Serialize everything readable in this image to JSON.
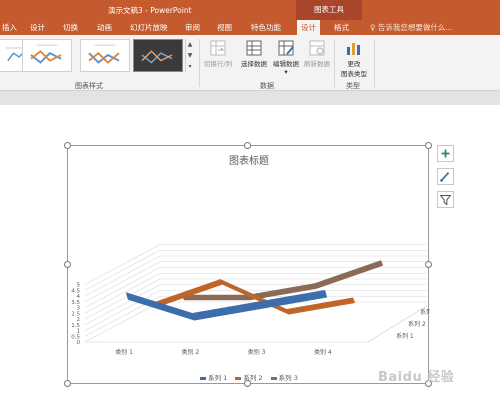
{
  "app": {
    "title": "演示文稿3 - PowerPoint",
    "context_group": "图表工具"
  },
  "tabs": [
    {
      "label": "插入"
    },
    {
      "label": "设计"
    },
    {
      "label": "切换"
    },
    {
      "label": "动画"
    },
    {
      "label": "幻灯片放映"
    },
    {
      "label": "审阅"
    },
    {
      "label": "视图"
    },
    {
      "label": "特色功能"
    },
    {
      "label": "设计",
      "active": true
    },
    {
      "label": "格式"
    }
  ],
  "tell_me": "告诉我您想要做什么...",
  "ribbon": {
    "groups": {
      "chart_styles": "图表样式",
      "data": "数据",
      "type": "类型"
    },
    "buttons": {
      "switch_row_col": "切换行/列",
      "select_data": "选择数据",
      "edit_data": "编辑数据",
      "refresh_data": "刷新数据",
      "change_chart_type_line1": "更改",
      "change_chart_type_line2": "图表类型"
    }
  },
  "chart_data": {
    "type": "line",
    "title": "图表标题",
    "categories": [
      "类别 1",
      "类别 2",
      "类别 3",
      "类别 4"
    ],
    "series": [
      {
        "name": "系列 1",
        "values": [
          4.3,
          2.5,
          3.5,
          4.5
        ],
        "color": "#3d6eab"
      },
      {
        "name": "系列 2",
        "values": [
          2.4,
          4.4,
          1.8,
          2.8
        ],
        "color": "#c0652a"
      },
      {
        "name": "系列 3",
        "values": [
          2.0,
          2.0,
          3.0,
          5.0
        ],
        "color": "#8c6a58"
      }
    ],
    "y_ticks": [
      "0",
      "0.5",
      "1",
      "1.5",
      "2",
      "2.5",
      "3",
      "3.5",
      "4",
      "4.5",
      "5"
    ],
    "depth_labels": [
      "系列 1",
      "系列 2",
      "系列 3"
    ],
    "ylim": [
      0,
      5
    ],
    "grid": true,
    "legend": "bottom"
  },
  "watermark": "Baidu 经验",
  "colors": {
    "accent": "#c55a2e",
    "ribbon_bg": "#f3f3f3"
  }
}
